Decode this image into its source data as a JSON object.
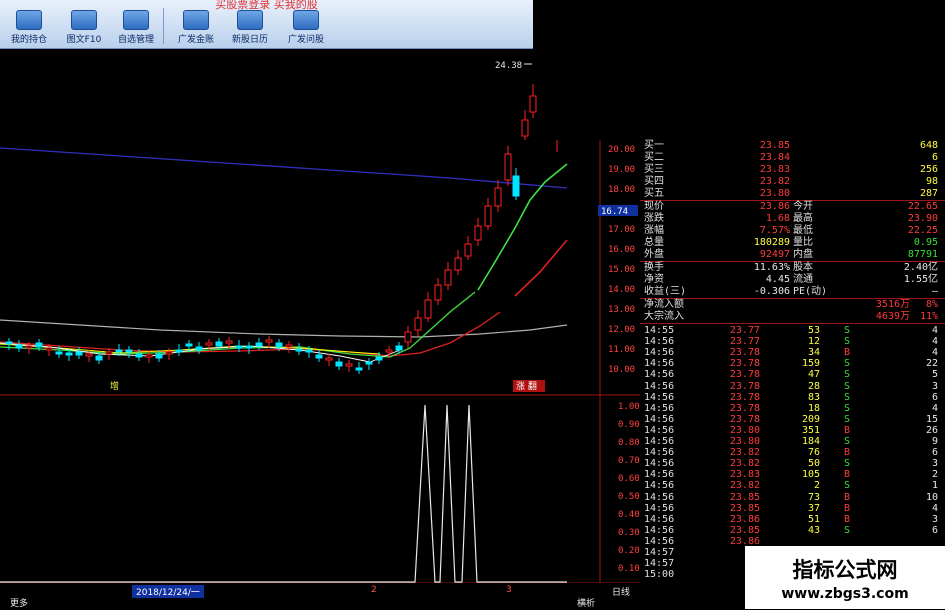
{
  "window": {
    "title": "买股票登录  买我的股"
  },
  "toolbar": {
    "buttons": [
      {
        "label": "我的持仓",
        "icon": "holdings-icon"
      },
      {
        "label": "图文F10",
        "icon": "f10-icon"
      },
      {
        "label": "自选管理",
        "icon": "watchlist-icon"
      },
      {
        "label": "广发金账",
        "icon": "account-icon"
      },
      {
        "label": "新股日历",
        "icon": "calendar-icon"
      },
      {
        "label": "广发问股",
        "icon": "ask-icon"
      }
    ]
  },
  "chart": {
    "high_label": "24.38",
    "price_axis": [
      "20.00",
      "19.00",
      "18.00",
      "17.00",
      "16.00",
      "15.00",
      "14.00",
      "13.00",
      "12.00",
      "11.00",
      "10.00"
    ],
    "current_price_tag": "16.74",
    "indicator_axis": [
      "1.00",
      "0.90",
      "0.80",
      "0.70",
      "0.60",
      "0.50",
      "0.40",
      "0.30",
      "0.20",
      "0.10"
    ],
    "marker_left": "增",
    "marker_right": "涨 翻",
    "bottom_bar": {
      "left_label": "更多",
      "date_label": "2018/12/24/一",
      "mark_2": "2",
      "mark_3": "3",
      "period_label": "日线",
      "tab_label": "横析"
    },
    "colors": {
      "up": "#ff2020",
      "down": "#00e5ff",
      "ma_short": "#ffffff",
      "ma_mid": "#ffff00",
      "ma_green": "#40e040",
      "ma_red": "#e02020",
      "ma_gray": "#b0b0b0",
      "ma_blue": "#3030c0"
    }
  },
  "quote": {
    "bids": [
      {
        "label": "买一",
        "price": "23.85",
        "volume": "648"
      },
      {
        "label": "买二",
        "price": "23.84",
        "volume": "6"
      },
      {
        "label": "买三",
        "price": "23.83",
        "volume": "256"
      },
      {
        "label": "买四",
        "price": "23.82",
        "volume": "98"
      },
      {
        "label": "买五",
        "price": "23.80",
        "volume": "287"
      }
    ],
    "stats": [
      {
        "l1": "现价",
        "v1": "23.86",
        "l2": "今开",
        "v2": "22.65"
      },
      {
        "l1": "涨跌",
        "v1": "1.68",
        "l2": "最高",
        "v2": "23.90"
      },
      {
        "l1": "涨幅",
        "v1": "7.57%",
        "l2": "最低",
        "v2": "22.25"
      },
      {
        "l1": "总量",
        "v1": "180289",
        "l2": "量比",
        "v2": "0.95"
      },
      {
        "l1": "外盘",
        "v1": "92497",
        "l2": "内盘",
        "v2": "87791"
      },
      {
        "l1": "换手",
        "v1": "11.63%",
        "l2": "股本",
        "v2": "2.40亿"
      },
      {
        "l1": "净资",
        "v1": "4.45",
        "l2": "流通",
        "v2": "1.55亿"
      },
      {
        "l1": "收益(三)",
        "v1": "-0.306",
        "l2": "PE(动)",
        "v2": "—"
      }
    ],
    "flows": [
      {
        "label": "净流入额",
        "value": "3516万",
        "pct": "8%"
      },
      {
        "label": "大宗流入",
        "value": "4639万",
        "pct": "11%"
      }
    ],
    "ticks": [
      {
        "time": "14:55",
        "price": "23.77",
        "vol": "53",
        "bs": "S",
        "num": "4"
      },
      {
        "time": "14:56",
        "price": "23.77",
        "vol": "12",
        "bs": "S",
        "num": "4"
      },
      {
        "time": "14:56",
        "price": "23.78",
        "vol": "34",
        "bs": "B",
        "num": "4"
      },
      {
        "time": "14:56",
        "price": "23.78",
        "vol": "159",
        "bs": "S",
        "num": "22"
      },
      {
        "time": "14:56",
        "price": "23.78",
        "vol": "47",
        "bs": "S",
        "num": "5"
      },
      {
        "time": "14:56",
        "price": "23.78",
        "vol": "28",
        "bs": "S",
        "num": "3"
      },
      {
        "time": "14:56",
        "price": "23.78",
        "vol": "83",
        "bs": "S",
        "num": "6"
      },
      {
        "time": "14:56",
        "price": "23.78",
        "vol": "18",
        "bs": "S",
        "num": "4"
      },
      {
        "time": "14:56",
        "price": "23.78",
        "vol": "209",
        "bs": "S",
        "num": "15"
      },
      {
        "time": "14:56",
        "price": "23.80",
        "vol": "351",
        "bs": "B",
        "num": "26"
      },
      {
        "time": "14:56",
        "price": "23.80",
        "vol": "184",
        "bs": "S",
        "num": "9"
      },
      {
        "time": "14:56",
        "price": "23.82",
        "vol": "76",
        "bs": "B",
        "num": "6"
      },
      {
        "time": "14:56",
        "price": "23.82",
        "vol": "50",
        "bs": "S",
        "num": "3"
      },
      {
        "time": "14:56",
        "price": "23.83",
        "vol": "105",
        "bs": "B",
        "num": "2"
      },
      {
        "time": "14:56",
        "price": "23.82",
        "vol": "2",
        "bs": "S",
        "num": "1"
      },
      {
        "time": "14:56",
        "price": "23.85",
        "vol": "73",
        "bs": "B",
        "num": "10"
      },
      {
        "time": "14:56",
        "price": "23.85",
        "vol": "37",
        "bs": "B",
        "num": "4"
      },
      {
        "time": "14:56",
        "price": "23.86",
        "vol": "51",
        "bs": "B",
        "num": "3"
      },
      {
        "time": "14:56",
        "price": "23.85",
        "vol": "43",
        "bs": "S",
        "num": "6"
      },
      {
        "time": "14:56",
        "price": "23.86",
        "vol": "",
        "bs": "",
        "num": ""
      },
      {
        "time": "14:57",
        "price": "",
        "vol": "",
        "bs": "",
        "num": ""
      },
      {
        "time": "14:57",
        "price": "",
        "vol": "",
        "bs": "",
        "num": ""
      },
      {
        "time": "15:00",
        "price": "",
        "vol": "",
        "bs": "",
        "num": ""
      }
    ]
  },
  "watermark": {
    "line1": "指标公式网",
    "line2": "www.zbgs3.com"
  }
}
